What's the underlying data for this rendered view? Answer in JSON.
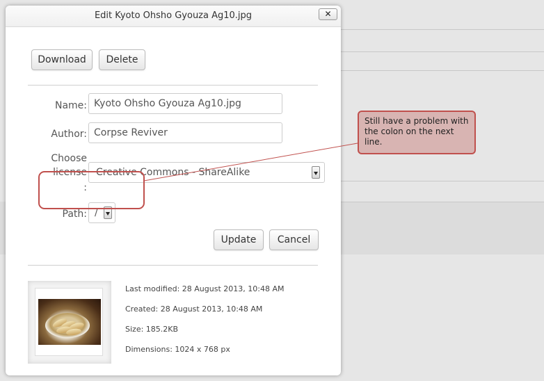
{
  "dialog": {
    "title": "Edit Kyoto Ohsho Gyouza Ag10.jpg",
    "close_label": "✕"
  },
  "actions": {
    "download_label": "Download",
    "delete_label": "Delete"
  },
  "form": {
    "name_label": "Name:",
    "name_value": "Kyoto Ohsho Gyouza Ag10.jpg",
    "author_label": "Author:",
    "author_value": "Corpse Reviver",
    "license_label_line1": "Choose",
    "license_label_line2": "license",
    "license_label_line3": ":",
    "license_value": "Creative Commons - ShareAlike",
    "path_label": "Path:",
    "path_value": "/",
    "update_label": "Update",
    "cancel_label": "Cancel"
  },
  "file_info": {
    "last_modified": "Last modified: 28 August 2013, 10:48 AM",
    "created": "Created: 28 August 2013, 10:48 AM",
    "size": "Size: 185.2KB",
    "dimensions": "Dimensions: 1024 x 768 px"
  },
  "annotation": {
    "text": "Still have a problem with the colon on the next line.",
    "color": "#c0504d",
    "fill": "#d8b4b2"
  },
  "background": {
    "ghost_text": "g"
  }
}
